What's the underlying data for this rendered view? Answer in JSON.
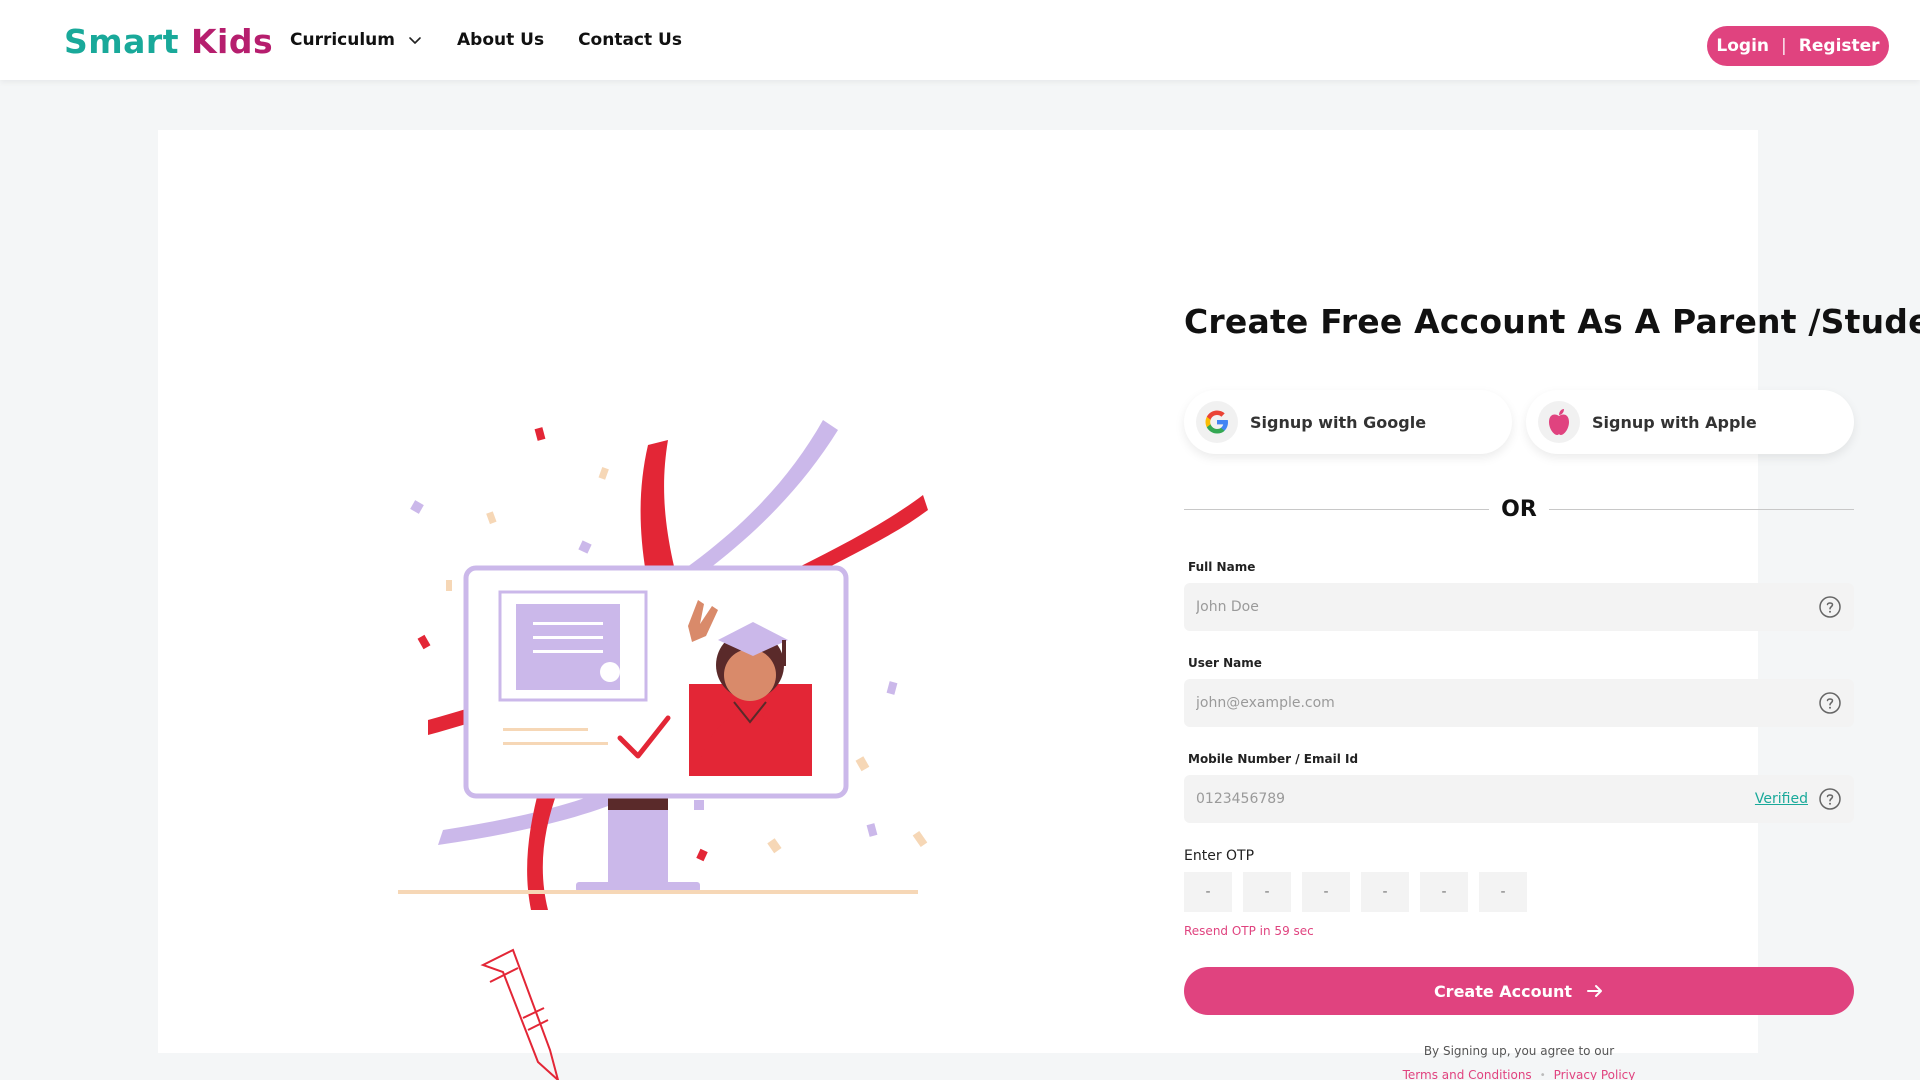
{
  "brand": {
    "part1": "Smart",
    "part2": "Kids"
  },
  "nav": {
    "curriculum": "Curriculum",
    "about": "About Us",
    "contact": "Contact Us"
  },
  "auth": {
    "login": "Login",
    "separator": "|",
    "register": "Register"
  },
  "form": {
    "title": "Create  Free  Account As A Parent /Student",
    "google_label": "Signup with Google",
    "apple_label": "Signup with Apple",
    "or_text": "OR",
    "full_name": {
      "label": "Full Name",
      "placeholder": "John Doe"
    },
    "user_name": {
      "label": "User Name",
      "placeholder": "john@example.com"
    },
    "mobile": {
      "label": "Mobile Number / Email Id",
      "placeholder": "0123456789",
      "status": "Verified"
    },
    "otp": {
      "label": "Enter OTP",
      "boxes": [
        "-",
        "-",
        "-",
        "-",
        "-",
        "-"
      ],
      "resend": "Resend OTP in 59 sec"
    },
    "submit_label": "Create Account",
    "agree_text": "By Signing up, you agree to our",
    "terms_label": "Terms and Conditions",
    "links_separator": "•",
    "privacy_label": "Privacy Policy"
  },
  "icons": {
    "nav_dropdown": "chevron-down-icon",
    "google": "google-icon",
    "apple": "apple-icon",
    "help": "question-circle-icon",
    "submit_arrow": "arrow-right-icon"
  },
  "colors": {
    "primary_pink": "#e0437f",
    "brand_teal": "#19a99a",
    "brand_magenta": "#b61e6e",
    "illustration_red": "#e32636",
    "illustration_lavender": "#cbb8ea"
  }
}
